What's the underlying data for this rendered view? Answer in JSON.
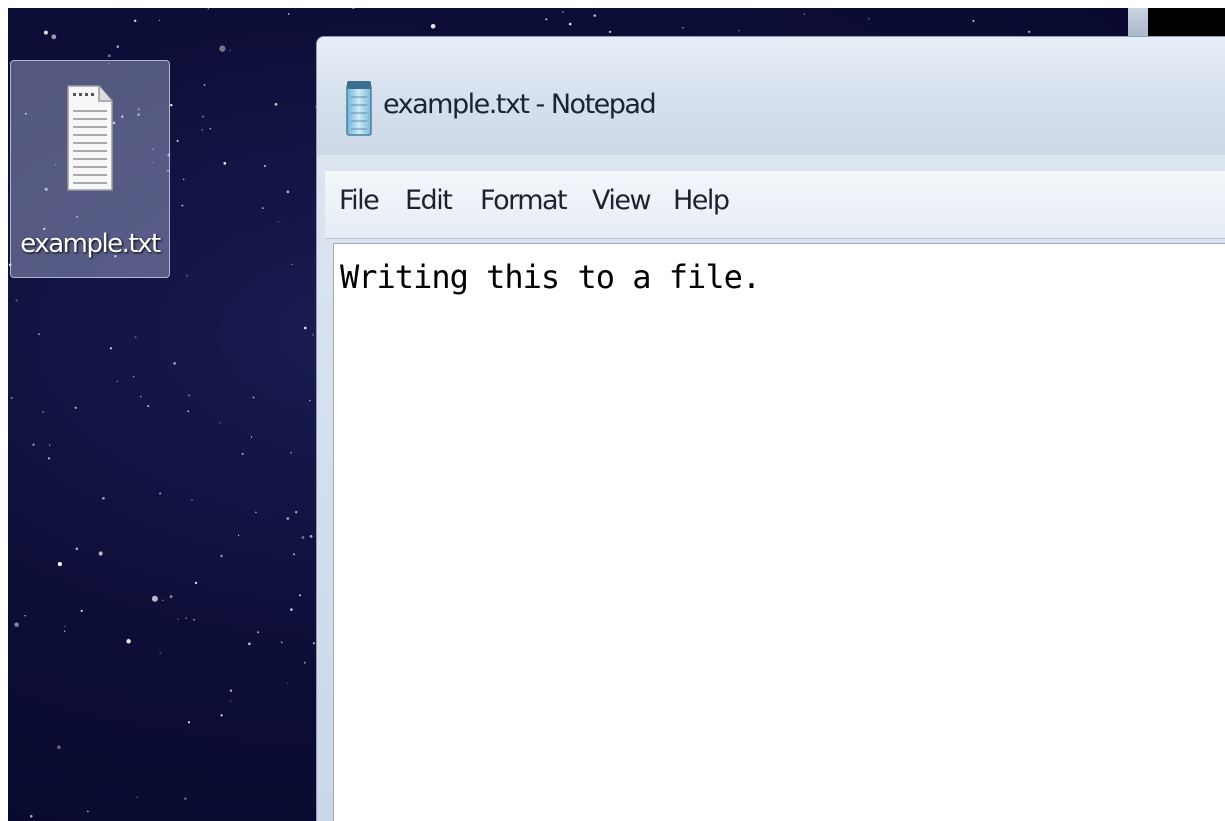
{
  "desktop": {
    "icons": [
      {
        "label": "example.txt",
        "icon": "text-file-icon"
      }
    ]
  },
  "window": {
    "title": "example.txt - Notepad",
    "icon": "notepad-icon",
    "menu": [
      {
        "label": "File"
      },
      {
        "label": "Edit"
      },
      {
        "label": "Format"
      },
      {
        "label": "View"
      },
      {
        "label": "Help"
      }
    ],
    "editor": {
      "content": "Writing this to a file."
    }
  },
  "colors": {
    "desktop_background": "#0d0e38",
    "window_chrome": "#d4dfec",
    "editor_background": "#ffffff"
  }
}
